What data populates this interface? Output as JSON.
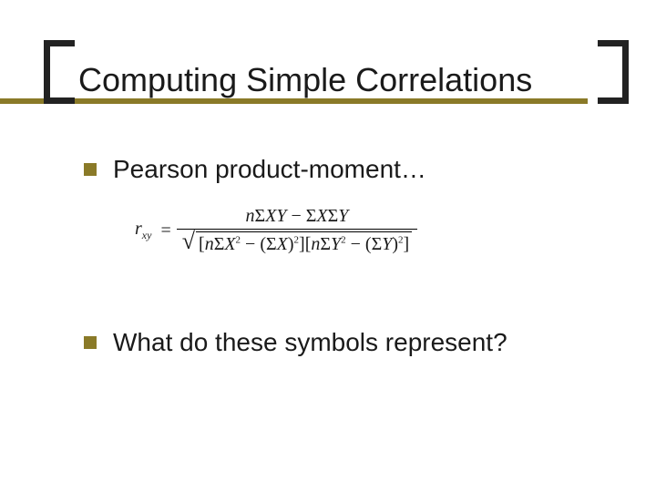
{
  "title": "Computing Simple Correlations",
  "bullets": {
    "b1": "Pearson product-moment…",
    "b2": "What do these symbols represent?"
  },
  "formula": {
    "lhs_var": "r",
    "lhs_sub": "xy",
    "eq": "=",
    "numerator": "nΣXY − ΣXΣY",
    "denominator_inner": "[nΣX² − (ΣX)²][nΣY² − (ΣY)²]"
  },
  "colors": {
    "accent": "#8a7a28",
    "text": "#1a1a1a"
  }
}
